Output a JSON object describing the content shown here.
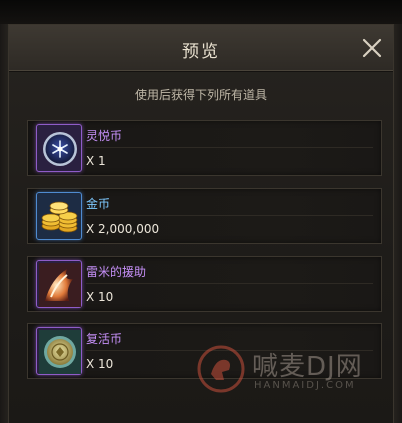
{
  "dialog": {
    "title": "预览",
    "subtitle": "使用后获得下列所有道具"
  },
  "items": [
    {
      "name": "灵悦币",
      "quantity": "X 1",
      "name_color": "#c58ff7",
      "icon": "spirit-coin-icon"
    },
    {
      "name": "金币",
      "quantity": "X 2,000,000",
      "name_color": "#7ec9ff",
      "icon": "gold-coins-icon"
    },
    {
      "name": "雷米的援助",
      "quantity": "X 10",
      "name_color": "#c58ff7",
      "icon": "remy-aid-icon"
    },
    {
      "name": "复活币",
      "quantity": "X 10",
      "name_color": "#c58ff7",
      "icon": "revive-coin-icon"
    }
  ],
  "watermark": {
    "text": "喊麦DJ网",
    "subtext": "HANMAIDJ.COM"
  }
}
